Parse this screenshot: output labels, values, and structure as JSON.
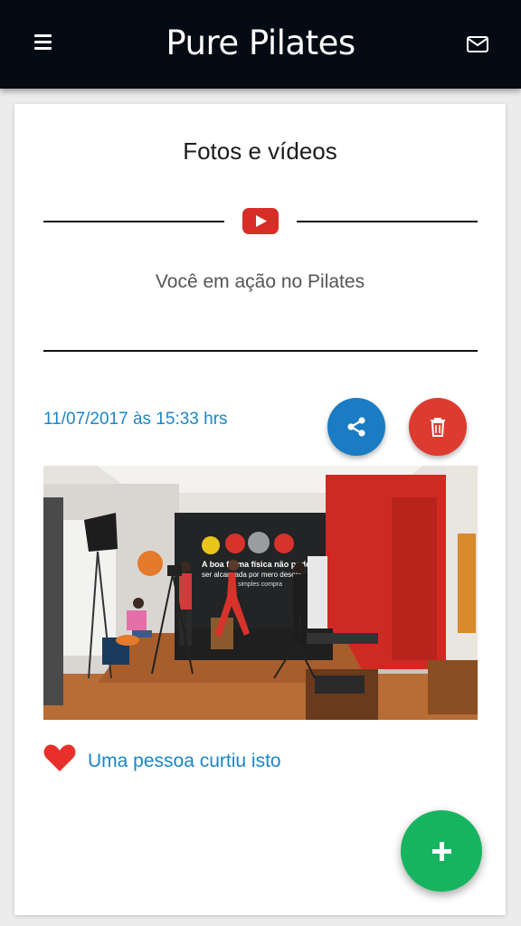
{
  "header": {
    "brand_name": "Pure Pilates",
    "menu_icon": "hamburger-menu-icon",
    "mail_icon": "mail-icon",
    "background_color": "#050b14",
    "brand_accent_color": "#d6262c"
  },
  "page": {
    "title": "Fotos e vídeos",
    "section_icon": "youtube-icon",
    "subtitle": "Você em ação no Pilates"
  },
  "post": {
    "timestamp": "11/07/2017 às 15:33 hrs",
    "share_icon": "share-icon",
    "delete_icon": "trash-icon",
    "photo": {
      "wall_text_line1": "A boa forma física não pode",
      "wall_text_line2": "ser alcançada por mero desejo",
      "wall_text_line3": "simples compra"
    },
    "like_icon": "heart-icon",
    "likes_text": "Uma pessoa curtiu isto"
  },
  "fab": {
    "icon": "plus-icon"
  },
  "colors": {
    "link_blue": "#1a86c7",
    "share_blue": "#1a7cc2",
    "delete_red": "#dd3b30",
    "add_green": "#17b45f",
    "heart_red": "#e8302b"
  }
}
